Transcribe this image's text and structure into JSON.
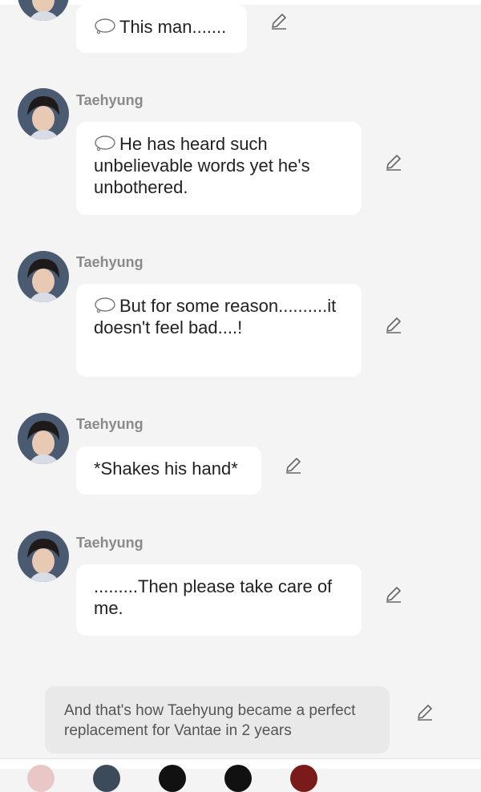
{
  "messages": [
    {
      "name": "",
      "text": "This man.......",
      "thought": true
    },
    {
      "name": "Taehyung",
      "text": "He has heard such unbelievable words yet he's unbothered.",
      "thought": true
    },
    {
      "name": "Taehyung",
      "text": "But for some reason..........it doesn't feel bad....!",
      "thought": true
    },
    {
      "name": "Taehyung",
      "text": "*Shakes his hand*",
      "thought": false
    },
    {
      "name": "Taehyung",
      "text": ".........Then please take care of me.",
      "thought": false
    }
  ],
  "narration": {
    "text": "And that's how Taehyung became a perfect replacement for Vantae in 2 years"
  },
  "icons": {
    "thought_bubble": "thought-bubble-icon",
    "edit": "pencil-icon"
  },
  "colors": {
    "background": "#f4f4f4",
    "bubble": "#ffffff",
    "name": "#8a8a8a",
    "narration_bg": "#e9e9e9"
  }
}
